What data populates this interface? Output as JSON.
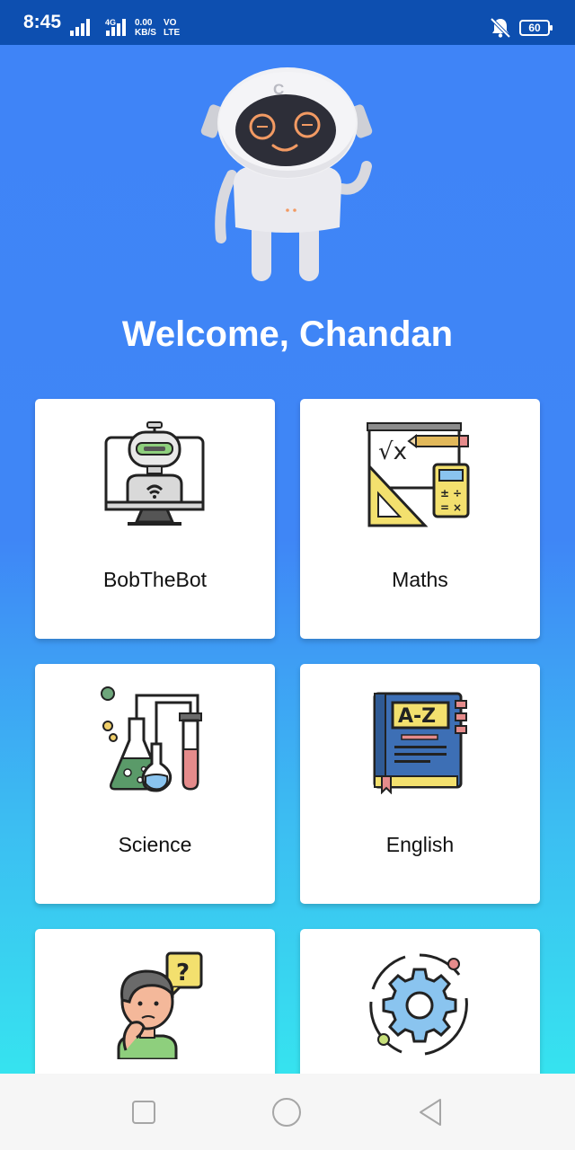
{
  "status_bar": {
    "time": "8:45",
    "network": "4G",
    "speed_value": "0.00",
    "speed_unit": "KB/S",
    "volte_top": "VO",
    "volte_bottom": "LTE",
    "battery": "60"
  },
  "greeting": "Welcome, Chandan",
  "cards": [
    {
      "label": "BobTheBot",
      "icon": "bot-laptop-icon"
    },
    {
      "label": "Maths",
      "icon": "math-board-icon"
    },
    {
      "label": "Science",
      "icon": "lab-flasks-icon"
    },
    {
      "label": "English",
      "icon": "az-book-icon"
    },
    {
      "label": "",
      "icon": "thinking-person-icon"
    },
    {
      "label": "",
      "icon": "settings-gear-icon"
    }
  ],
  "nav": [
    "recent-apps",
    "home",
    "back"
  ],
  "colors": {
    "status_bar": "#0d4fb0",
    "gradient_top": "#3f84f7",
    "gradient_bottom": "#36e3ef"
  }
}
